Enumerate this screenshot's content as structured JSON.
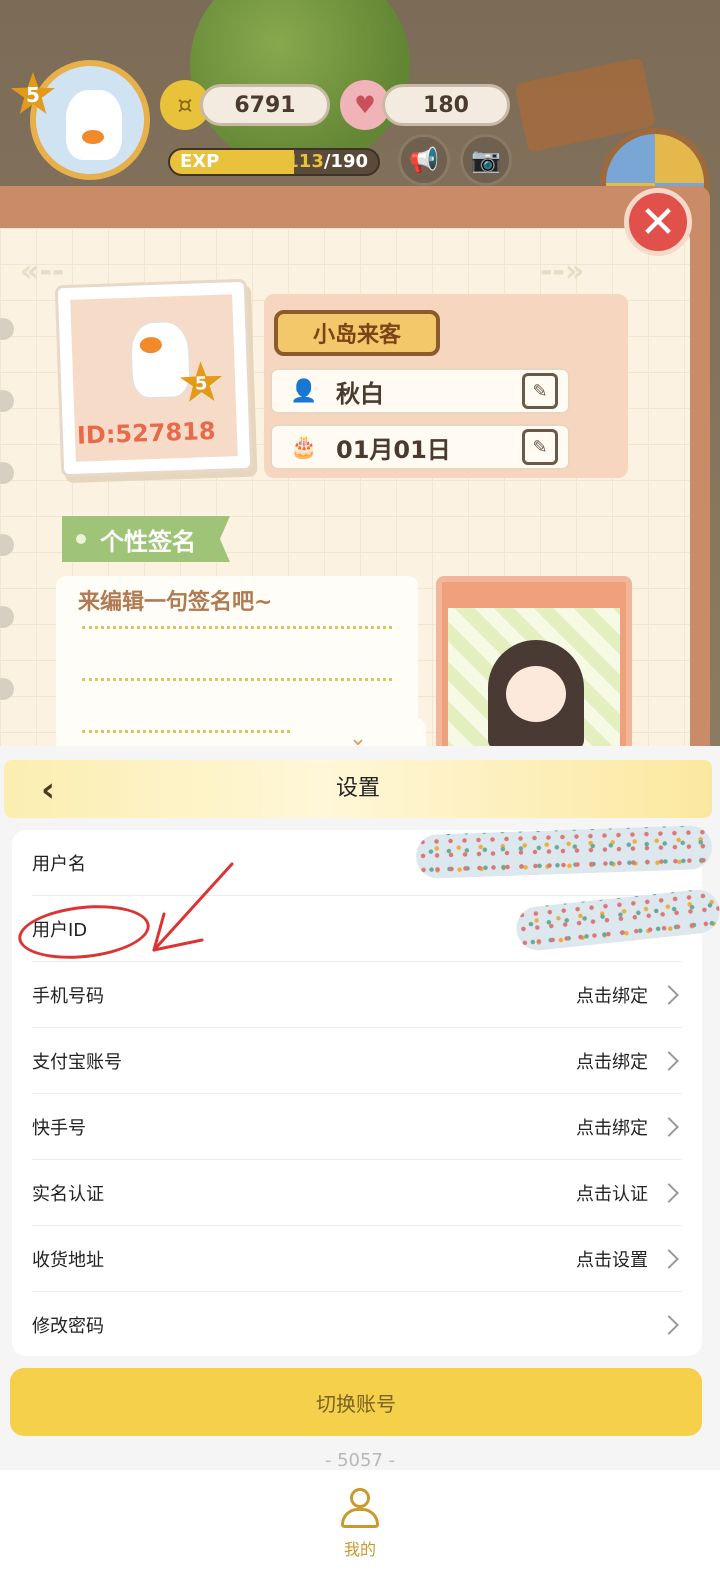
{
  "hud": {
    "level": "5",
    "coins": "6791",
    "hearts": "180",
    "exp_label": "EXP",
    "exp_current": "113",
    "exp_max": "/190",
    "exp_progress": 0.595
  },
  "profile": {
    "level": "5",
    "user_id": "ID:527818",
    "title_badge": "小岛来客",
    "nickname": "秋白",
    "birthday": "01月01日",
    "signature_tag": "个性签名",
    "signature_placeholder": "来编辑一句签名吧~"
  },
  "settings": {
    "title": "设置",
    "rows": [
      {
        "label": "用户名",
        "value": ""
      },
      {
        "label": "用户ID",
        "value": ""
      },
      {
        "label": "手机号码",
        "value": "点击绑定"
      },
      {
        "label": "支付宝账号",
        "value": "点击绑定"
      },
      {
        "label": "快手号",
        "value": "点击绑定"
      },
      {
        "label": "实名认证",
        "value": "点击认证"
      },
      {
        "label": "收货地址",
        "value": "点击设置"
      },
      {
        "label": "修改密码",
        "value": ""
      }
    ],
    "switch_account": "切换账号",
    "version": "- 5057 -"
  },
  "tabbar": {
    "me_label": "我的"
  },
  "icons": [
    "coin-icon",
    "broken-heart-icon",
    "megaphone-icon",
    "camera-icon",
    "close-icon",
    "user-icon",
    "cake-icon",
    "edit-icon",
    "chevron-left-icon",
    "chevron-right-icon",
    "chevron-down-icon",
    "person-tab-icon"
  ],
  "colors": {
    "accent": "#f5d04a",
    "annotation": "#d33333"
  }
}
